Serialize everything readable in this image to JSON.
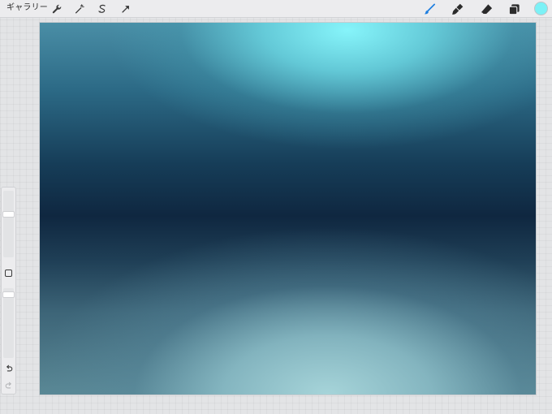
{
  "topbar": {
    "gallery_label": "ギャラリー",
    "left_tools": [
      "wrench-icon",
      "magic-wand-icon",
      "selection-icon",
      "transform-arrow-icon"
    ],
    "right_tools": [
      "brush-icon",
      "smudge-icon",
      "eraser-icon",
      "layers-icon"
    ],
    "active_tool": "brush-icon",
    "active_color": "#7cf1f6",
    "brush_accent": "#1f7fe0"
  },
  "sidebar": {
    "brush_size_level": 0.15,
    "opacity_level": 0.1,
    "controls": [
      "modify-button",
      "undo-icon",
      "redo-icon"
    ]
  },
  "canvas": {
    "colors": [
      "#86f4fa",
      "#2c6a86",
      "#0f2740",
      "#a6d4d9"
    ]
  }
}
